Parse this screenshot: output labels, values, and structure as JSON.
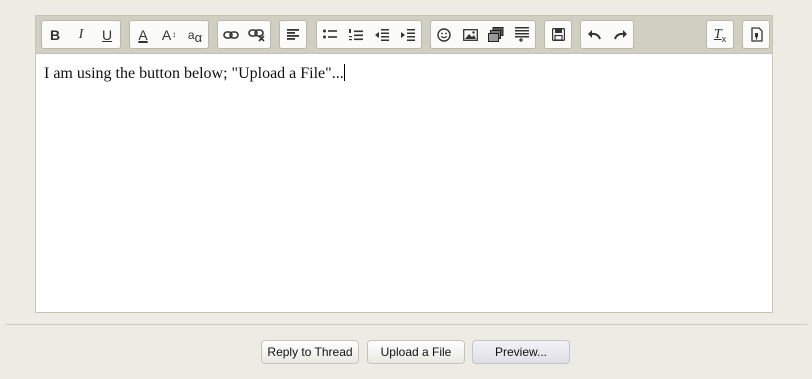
{
  "editor": {
    "content": "I am using the button below; \"Upload a File\"...",
    "toolbar": {
      "bold": "B",
      "italic": "I",
      "underline": "U",
      "font_color": "A",
      "font_size": "A",
      "font_size_arrows": "↕",
      "font_family": "a",
      "font_family_alt": "α",
      "remove_format": "T",
      "remove_format_sub": "x"
    }
  },
  "buttons": {
    "reply": "Reply to Thread",
    "upload": "Upload a File",
    "preview": "Preview..."
  }
}
